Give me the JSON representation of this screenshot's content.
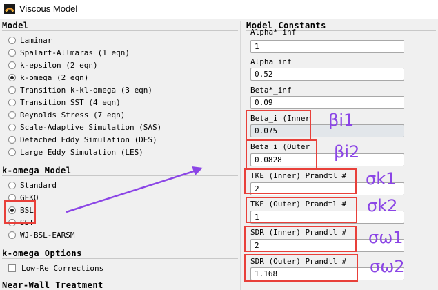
{
  "window": {
    "title": "Viscous Model"
  },
  "model": {
    "title": "Model",
    "options": [
      "Laminar",
      "Spalart-Allmaras (1 eqn)",
      "k-epsilon (2 eqn)",
      "k-omega (2 eqn)",
      "Transition k-kl-omega (3 eqn)",
      "Transition SST (4 eqn)",
      "Reynolds Stress (7 eqn)",
      "Scale-Adaptive Simulation (SAS)",
      "Detached Eddy Simulation (DES)",
      "Large Eddy Simulation (LES)"
    ],
    "selected": "k-omega (2 eqn)"
  },
  "komega_model": {
    "title": "k-omega Model",
    "options": [
      "Standard",
      "GEKO",
      "BSL",
      "SST",
      "WJ-BSL-EARSM"
    ],
    "selected": "BSL"
  },
  "komega_options": {
    "title": "k-omega Options",
    "low_re_label": "Low-Re Corrections",
    "low_re_checked": false
  },
  "near_wall": {
    "title": "Near-Wall Treatment"
  },
  "constants": {
    "title": "Model Constants",
    "items": [
      {
        "label": "Alpha*_inf",
        "value": "1"
      },
      {
        "label": "Alpha_inf",
        "value": "0.52"
      },
      {
        "label": "Beta*_inf",
        "value": "0.09"
      },
      {
        "label": "Beta_i (Inner)",
        "value": "0.075"
      },
      {
        "label": "Beta_i (Outer)",
        "value": "0.0828"
      },
      {
        "label": "TKE (Inner) Prandtl #",
        "value": "2"
      },
      {
        "label": "TKE (Outer) Prandtl #",
        "value": "1"
      },
      {
        "label": "SDR (Inner) Prandtl #",
        "value": "2"
      },
      {
        "label": "SDR (Outer) Prandtl #",
        "value": "1.168"
      }
    ]
  },
  "annotations": {
    "labels": [
      "βi1",
      "βi2",
      "σk1",
      "σk2",
      "σω1",
      "σω2"
    ],
    "highlight_color": "#e8403a",
    "text_color": "#8b45e6"
  },
  "colors": {
    "background": "#f0f0f0",
    "input_disabled": "#e2e6ea"
  }
}
